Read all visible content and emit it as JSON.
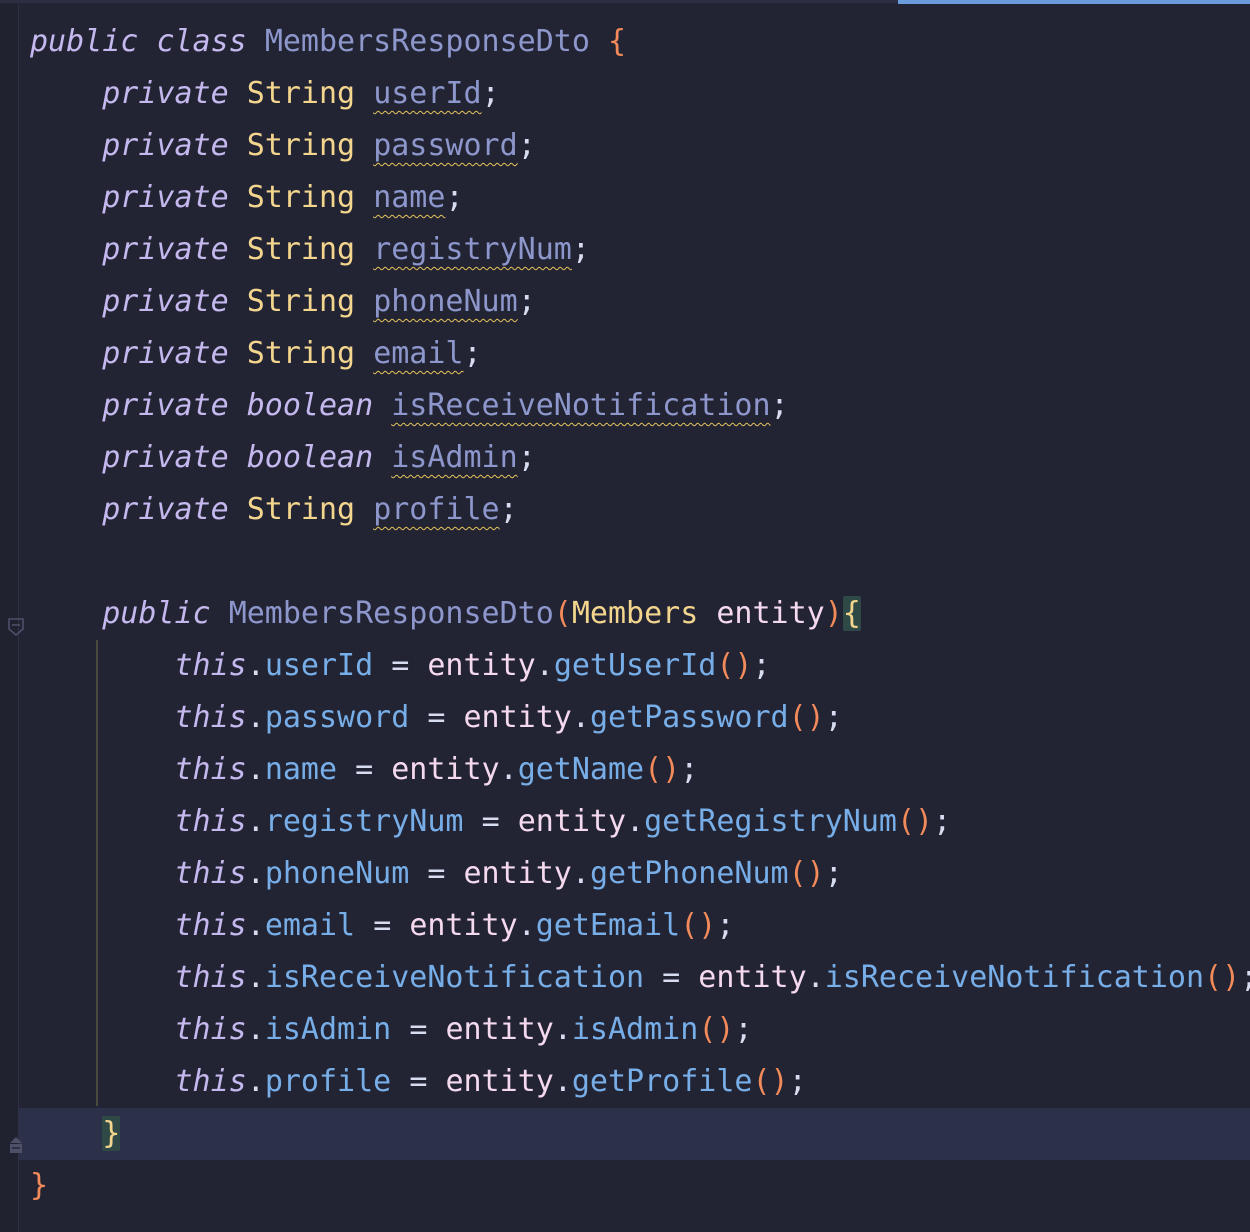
{
  "code": {
    "class_decl": {
      "modifier": "public",
      "keyword": "class",
      "name": "MembersResponseDto",
      "open_brace": "{"
    },
    "fields": [
      {
        "modifier": "private",
        "type": "String",
        "name": "userId"
      },
      {
        "modifier": "private",
        "type": "String",
        "name": "password"
      },
      {
        "modifier": "private",
        "type": "String",
        "name": "name"
      },
      {
        "modifier": "private",
        "type": "String",
        "name": "registryNum"
      },
      {
        "modifier": "private",
        "type": "String",
        "name": "phoneNum"
      },
      {
        "modifier": "private",
        "type": "String",
        "name": "email"
      },
      {
        "modifier": "private",
        "type": "boolean",
        "name": "isReceiveNotification"
      },
      {
        "modifier": "private",
        "type": "boolean",
        "name": "isAdmin"
      },
      {
        "modifier": "private",
        "type": "String",
        "name": "profile"
      }
    ],
    "constructor": {
      "modifier": "public",
      "name": "MembersResponseDto",
      "param_type": "Members",
      "param_name": "entity",
      "open_brace": "{",
      "close_brace": "}"
    },
    "assignments": [
      {
        "self": "this",
        "field": "userId",
        "obj": "entity",
        "method": "getUserId"
      },
      {
        "self": "this",
        "field": "password",
        "obj": "entity",
        "method": "getPassword"
      },
      {
        "self": "this",
        "field": "name",
        "obj": "entity",
        "method": "getName"
      },
      {
        "self": "this",
        "field": "registryNum",
        "obj": "entity",
        "method": "getRegistryNum"
      },
      {
        "self": "this",
        "field": "phoneNum",
        "obj": "entity",
        "method": "getPhoneNum"
      },
      {
        "self": "this",
        "field": "email",
        "obj": "entity",
        "method": "getEmail"
      },
      {
        "self": "this",
        "field": "isReceiveNotification",
        "obj": "entity",
        "method": "isReceiveNotification"
      },
      {
        "self": "this",
        "field": "isAdmin",
        "obj": "entity",
        "method": "isAdmin"
      },
      {
        "self": "this",
        "field": "profile",
        "obj": "entity",
        "method": "getProfile"
      }
    ],
    "class_close_brace": "}"
  },
  "icons": {
    "gutter_fold": "fold-marker-icon",
    "gutter_lock": "lock-icon"
  },
  "colors": {
    "background": "#222434",
    "keyword": "#c5b8ee",
    "type": "#f3d58e",
    "class_name": "#8d97cc",
    "brace": "#f28a5a",
    "field": "#78aee8",
    "param": "#f5d9ee",
    "warning_underline": "#e6c45a",
    "current_line": "#2c3048",
    "scroll_indicator": "#6a9bdc"
  }
}
